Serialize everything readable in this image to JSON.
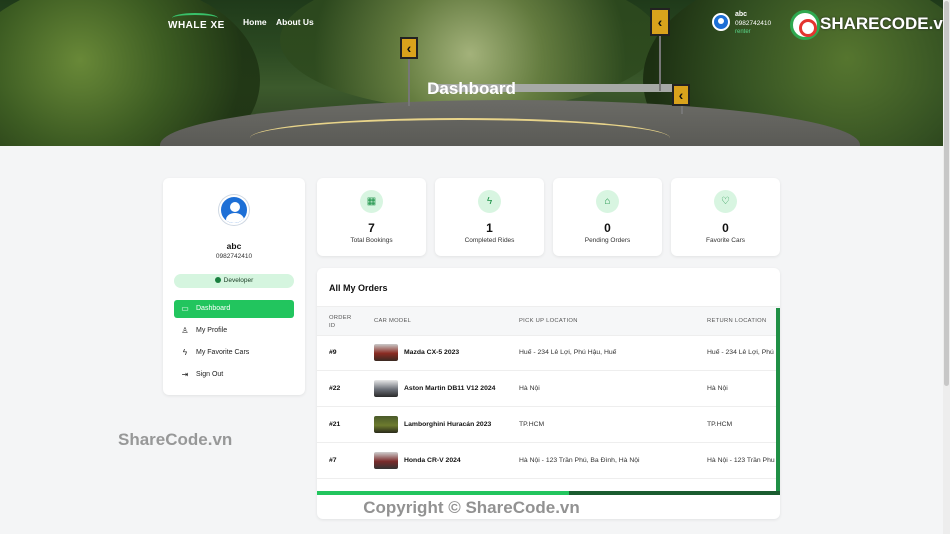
{
  "nav": {
    "brand": "WHALE XE",
    "links": [
      "Home",
      "About Us"
    ],
    "user": {
      "name": "abc",
      "phone": "0982742410",
      "role": "renter"
    }
  },
  "hero": {
    "title": "Dashboard"
  },
  "watermark": {
    "top": "SHARECODE.vn",
    "middle": "ShareCode.vn",
    "bottom": "Copyright © ShareCode.vn"
  },
  "profile": {
    "name": "abc",
    "phone": "0982742410",
    "badge": "Developer",
    "menu": [
      {
        "label": "Dashboard",
        "icon": "folder-icon",
        "active": true
      },
      {
        "label": "My Profile",
        "icon": "user-icon",
        "active": false
      },
      {
        "label": "My Favorite Cars",
        "icon": "bolt-icon",
        "active": false
      },
      {
        "label": "Sign Out",
        "icon": "sign-out-icon",
        "active": false
      }
    ]
  },
  "stats": [
    {
      "value": "7",
      "label": "Total Bookings",
      "icon": "calendar-icon"
    },
    {
      "value": "1",
      "label": "Completed Rides",
      "icon": "bolt-icon"
    },
    {
      "value": "0",
      "label": "Pending Orders",
      "icon": "bank-icon"
    },
    {
      "value": "0",
      "label": "Favorite Cars",
      "icon": "heart-icon"
    }
  ],
  "orders": {
    "title": "All My Orders",
    "columns": [
      "ORDER ID",
      "CAR MODEL",
      "PICK UP LOCATION",
      "RETURN LOCATION"
    ],
    "rows": [
      {
        "id": "#9",
        "model": "Mazda CX-5 2023",
        "pickup": "Huế - 234 Lê Lợi, Phú Hậu, Huế",
        "return": "Huế - 234 Lê Lợi, Phú",
        "thumb": "#8a2b22"
      },
      {
        "id": "#22",
        "model": "Aston Martin DB11 V12 2024",
        "pickup": "Hà Nội",
        "return": "Hà Nội",
        "thumb": "#6b6f77"
      },
      {
        "id": "#21",
        "model": "Lamborghini Huracán 2023",
        "pickup": "TP.HCM",
        "return": "TP.HCM",
        "thumb": "#6d7b2e"
      },
      {
        "id": "#7",
        "model": "Honda CR-V 2024",
        "pickup": "Hà Nội - 123 Trần Phú, Ba Đình, Hà Nội",
        "return": "Hà Nội - 123 Trần Phu",
        "thumb": "#7a2b2b"
      }
    ]
  }
}
